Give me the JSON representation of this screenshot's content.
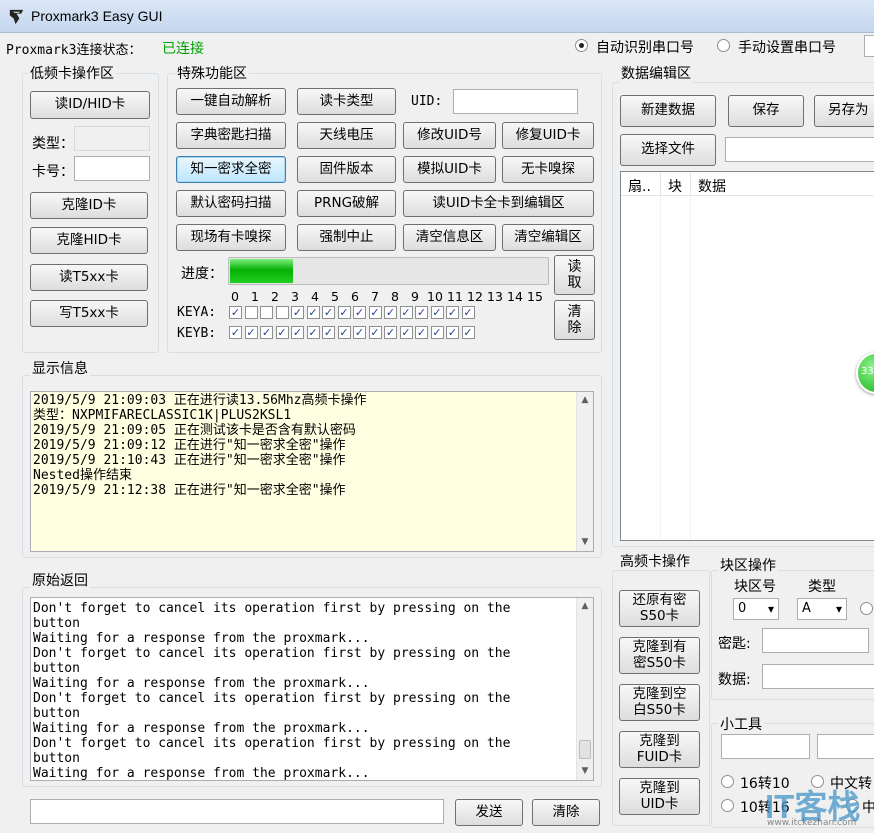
{
  "app": {
    "title": "Proxmark3 Easy GUI"
  },
  "status": {
    "label": "Proxmark3连接状态：",
    "value": "已连接",
    "value_color": "#00a000"
  },
  "port": {
    "auto_label": "自动识别串口号",
    "manual_label": "手动设置串口号"
  },
  "low": {
    "title": "低频卡操作区",
    "read_btn": "读ID/HID卡",
    "type_label": "类型：",
    "card_label": "卡号：",
    "clone_id": "克隆ID卡",
    "clone_hid": "克隆HID卡",
    "read_t5": "读T5xx卡",
    "write_t5": "写T5xx卡"
  },
  "special": {
    "title": "特殊功能区",
    "b_auto": "一键自动解析",
    "b_readtype": "读卡类型",
    "uid_label": "UID:",
    "b_dict": "字典密匙扫描",
    "b_antenna": "天线电压",
    "b_moduid": "修改UID号",
    "b_fixuid": "修复UID卡",
    "b_know": "知一密求全密",
    "b_fw": "固件版本",
    "b_simuid": "模拟UID卡",
    "b_nocard": "无卡嗅探",
    "b_default": "默认密码扫描",
    "b_prng": "PRNG破解",
    "b_readall": "读UID卡全卡到编辑区",
    "b_sniff": "现场有卡嗅探",
    "b_stop": "强制中止",
    "b_clearinfo": "清空信息区",
    "b_clearedit": "清空编辑区",
    "progress_label": "进度：",
    "progress": 0.2,
    "b_read": "读取",
    "b_clear": "清除",
    "sectors": [
      "0",
      "1",
      "2",
      "3",
      "4",
      "5",
      "6",
      "7",
      "8",
      "9",
      "10",
      "11",
      "12",
      "13",
      "14",
      "15"
    ],
    "keya_label": "KEYA:",
    "keyb_label": "KEYB:",
    "keya": [
      1,
      0,
      0,
      0,
      1,
      1,
      1,
      1,
      1,
      1,
      1,
      1,
      1,
      1,
      1,
      1
    ],
    "keyb": [
      1,
      1,
      1,
      1,
      1,
      1,
      1,
      1,
      1,
      1,
      1,
      1,
      1,
      1,
      1,
      1
    ]
  },
  "display": {
    "title": "显示信息",
    "lines": [
      "2019/5/9 21:09:03 正在进行读13.56Mhz高频卡操作",
      "类型：NXPMIFARECLASSIC1K|PLUS2KSL1",
      "2019/5/9 21:09:05 正在测试该卡是否含有默认密码",
      "2019/5/9 21:09:12 正在进行\"知一密求全密\"操作",
      "2019/5/9 21:10:43 正在进行\"知一密求全密\"操作",
      "Nested操作结束",
      "2019/5/9 21:12:38 正在进行\"知一密求全密\"操作"
    ]
  },
  "raw": {
    "title": "原始返回",
    "lines": [
      "Don't forget to cancel its operation first by pressing on the",
      "button",
      "Waiting for a response from the proxmark...",
      "Don't forget to cancel its operation first by pressing on the",
      "button",
      "Waiting for a response from the proxmark...",
      "Don't forget to cancel its operation first by pressing on the",
      "button",
      "Waiting for a response from the proxmark...",
      "Don't forget to cancel its operation first by pressing on the",
      "button",
      "Waiting for a response from the proxmark..."
    ]
  },
  "send": {
    "send_btn": "发送",
    "clear_btn": "清除"
  },
  "editor": {
    "title": "数据编辑区",
    "new_btn": "新建数据",
    "save_btn": "保存",
    "saveas_btn": "另存为",
    "choose_btn": "选择文件",
    "col_sector": "扇..",
    "col_block": "块",
    "col_data": "数据",
    "badge": "33"
  },
  "hf": {
    "title": "高频卡操作",
    "b1": "还原有密S50卡",
    "b2": "克隆到有密S50卡",
    "b3": "克隆到空白S50卡",
    "b4": "克隆到FUID卡",
    "b5": "克隆到UID卡"
  },
  "block": {
    "title": "块区操作",
    "blockno_label": "块区号",
    "type_label": "类型",
    "blockno_value": "0",
    "type_value": "A",
    "key_label": "密匙:",
    "data_label": "数据:"
  },
  "tools": {
    "title": "小工具",
    "r1": "16转10",
    "r2": "中文转",
    "r3": "10转16",
    "r4": "中"
  },
  "watermark": {
    "text": "IT客栈",
    "url": "www.itckezhan.com"
  }
}
